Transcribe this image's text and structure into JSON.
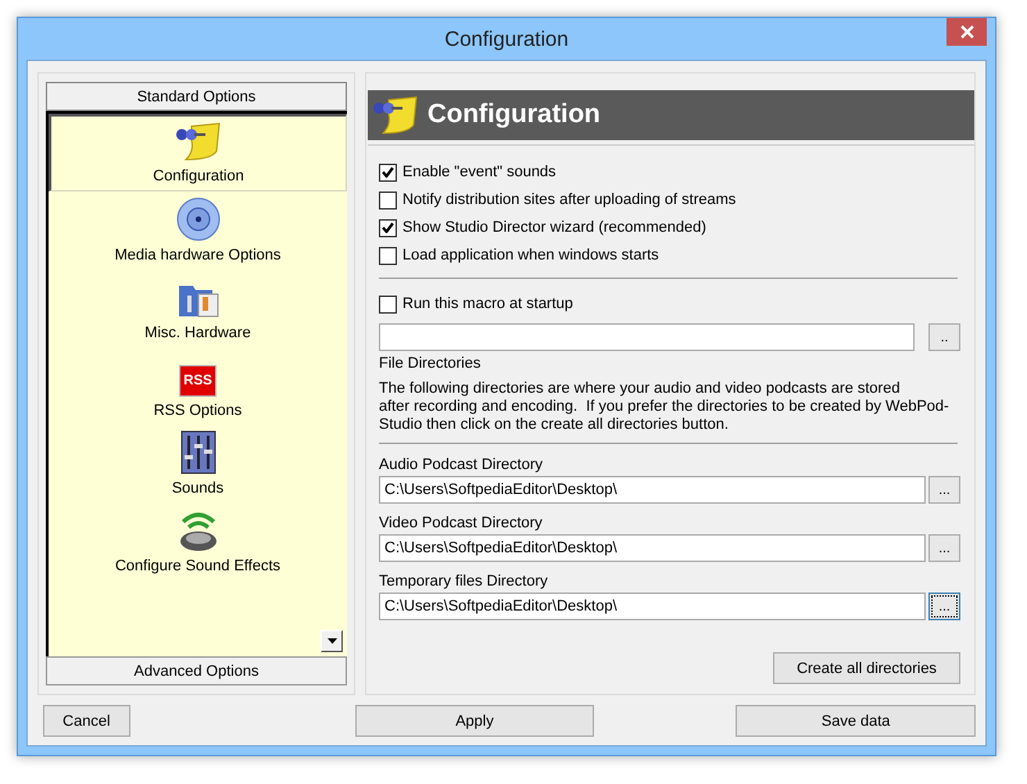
{
  "window": {
    "title": "Configuration"
  },
  "sidebar": {
    "header": "Standard Options",
    "footer": "Advanced Options",
    "items": [
      {
        "label": "Configuration",
        "selected": true
      },
      {
        "label": "Media hardware Options",
        "selected": false
      },
      {
        "label": "Misc. Hardware",
        "selected": false
      },
      {
        "label": "RSS Options",
        "selected": false,
        "icon_text": "RSS"
      },
      {
        "label": "Sounds",
        "selected": false
      },
      {
        "label": "Configure Sound Effects",
        "selected": false
      }
    ]
  },
  "panel": {
    "title": "Configuration",
    "options": [
      {
        "label": "Enable \"event\" sounds",
        "checked": true
      },
      {
        "label": "Notify distribution sites after uploading of streams",
        "checked": false
      },
      {
        "label": "Show Studio Director wizard (recommended)",
        "checked": true
      },
      {
        "label": "Load application when windows starts",
        "checked": false
      }
    ],
    "macro": {
      "label": "Run this macro at startup",
      "checked": false,
      "browse": ".."
    },
    "file_directories": {
      "heading": "File Directories",
      "description": "The following directories are where your audio and video podcasts are stored\nafter recording and encoding.  If you prefer the directories to be created by WebPod-\nStudio then click on the create all directories button."
    },
    "directories": [
      {
        "label": "Audio Podcast Directory",
        "value": "C:\\Users\\SoftpediaEditor\\Desktop\\",
        "browse": "...",
        "focused": false
      },
      {
        "label": "Video Podcast Directory",
        "value": "C:\\Users\\SoftpediaEditor\\Desktop\\",
        "browse": "...",
        "focused": false
      },
      {
        "label": "Temporary files Directory",
        "value": "C:\\Users\\SoftpediaEditor\\Desktop\\",
        "browse": "...",
        "focused": true
      }
    ],
    "create_button": "Create all directories"
  },
  "buttons": [
    "Cancel",
    "Apply",
    "Save data"
  ]
}
